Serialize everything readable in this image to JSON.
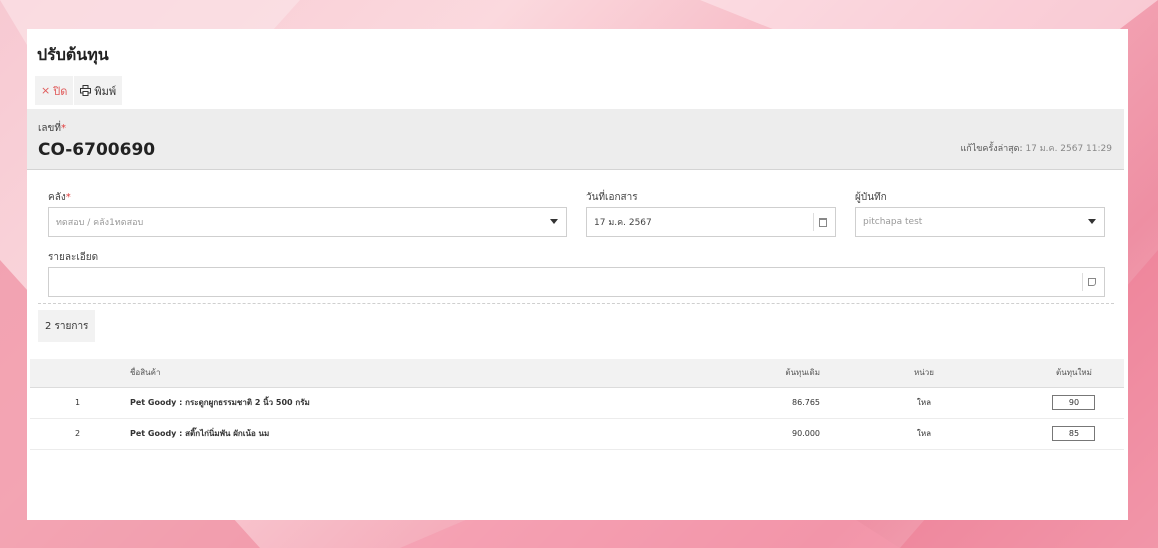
{
  "page": {
    "title": "ปรับต้นทุน"
  },
  "toolbar": {
    "close_label": "ปิด",
    "close_icon": "close-icon",
    "print_label": "พิมพ์",
    "print_icon": "printer-icon"
  },
  "header": {
    "doc_no_label": "เลขที่",
    "required_mark": "*",
    "doc_no": "CO-6700690",
    "last_edit_label": "แก้ไขครั้งล่าสุด:",
    "last_edit_value": "17 ม.ค. 2567 11:29"
  },
  "form": {
    "warehouse_label": "คลัง",
    "warehouse_value": "ทดสอบ / คลัง1ทดสอบ",
    "doc_date_label": "วันที่เอกสาร",
    "doc_date_value": "17 ม.ค. 2567",
    "recorder_label": "ผู้บันทึก",
    "recorder_value": "pitchapa test",
    "detail_label": "รายละเอียด",
    "detail_value": ""
  },
  "list": {
    "count_label": "2 รายการ",
    "columns": {
      "name": "ชื่อสินค้า",
      "cost": "ต้นทุนเดิม",
      "unit": "หน่วย",
      "new_cost": "ต้นทุนใหม่"
    },
    "rows": [
      {
        "no": "1",
        "name": "Pet Goody : กระดูกผูกธรรมชาติ 2 นิ้ว 500 กรัม",
        "cost": "86.765",
        "unit": "ใหล",
        "new_cost": "90"
      },
      {
        "no": "2",
        "name": "Pet Goody : สติ๊กไก่นิ่มพัน ผักเน้อ นม",
        "cost": "90.000",
        "unit": "ใหล",
        "new_cost": "85"
      }
    ]
  },
  "colors": {
    "accent_red": "#e03c3c",
    "header_band": "#ededed",
    "background_pink": "#f4a9b8"
  }
}
